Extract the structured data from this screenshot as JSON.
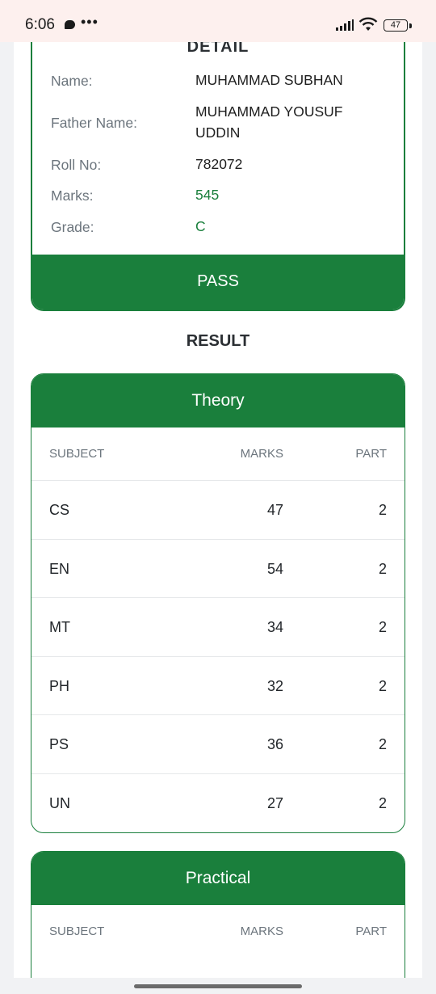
{
  "status_bar": {
    "time": "6:06",
    "dots": "•••",
    "battery": "47"
  },
  "detail": {
    "title": "DETAIL",
    "rows": [
      {
        "label": "Name:",
        "value": "MUHAMMAD SUBHAN"
      },
      {
        "label": "Father Name:",
        "value": "MUHAMMAD YOUSUF UDDIN"
      },
      {
        "label": "Roll No:",
        "value": "782072"
      },
      {
        "label": "Marks:",
        "value": "545"
      },
      {
        "label": "Grade:",
        "value": "C"
      }
    ],
    "status": "PASS"
  },
  "result_heading": "RESULT",
  "theory": {
    "title": "Theory",
    "columns": [
      "SUBJECT",
      "MARKS",
      "PART"
    ],
    "rows": [
      {
        "subject": "CS",
        "marks": "47",
        "part": "2"
      },
      {
        "subject": "EN",
        "marks": "54",
        "part": "2"
      },
      {
        "subject": "MT",
        "marks": "34",
        "part": "2"
      },
      {
        "subject": "PH",
        "marks": "32",
        "part": "2"
      },
      {
        "subject": "PS",
        "marks": "36",
        "part": "2"
      },
      {
        "subject": "UN",
        "marks": "27",
        "part": "2"
      }
    ]
  },
  "practical": {
    "title": "Practical",
    "columns": [
      "SUBJECT",
      "MARKS",
      "PART"
    ]
  },
  "colors": {
    "accent": "#1a7f3c",
    "label": "#6c757d"
  }
}
